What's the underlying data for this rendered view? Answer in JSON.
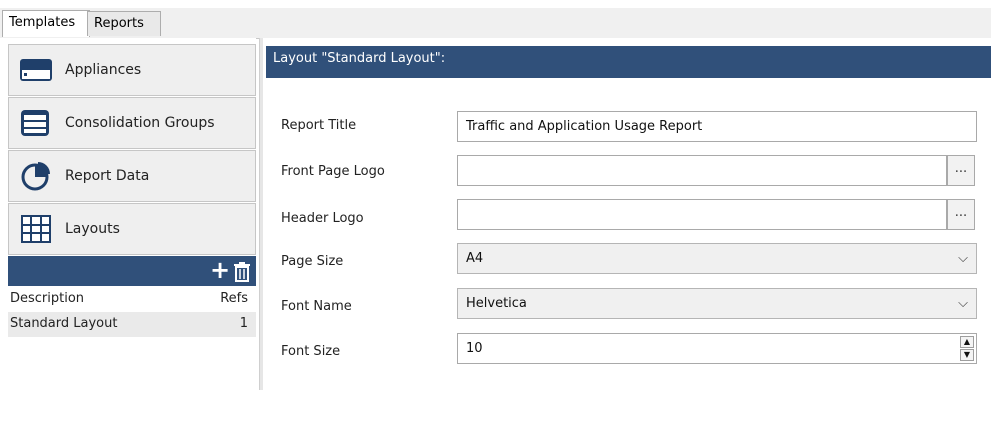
{
  "tabs": [
    {
      "label": "Templates"
    },
    {
      "label": "Reports"
    }
  ],
  "sidebar": {
    "items": [
      {
        "label": "Appliances",
        "icon": "appliance-icon"
      },
      {
        "label": "Consolidation Groups",
        "icon": "consolidation-groups-icon"
      },
      {
        "label": "Report Data",
        "icon": "pie-chart-icon"
      },
      {
        "label": "Layouts",
        "icon": "grid-icon"
      }
    ],
    "toolbar": {
      "add": "+",
      "delete_icon": "trash-icon"
    },
    "grid": {
      "columns": [
        "Description",
        "Refs"
      ],
      "rows": [
        {
          "description": "Standard Layout",
          "refs": "1"
        }
      ]
    }
  },
  "panel": {
    "header": "Layout \"Standard Layout\":",
    "fields": {
      "report_title": {
        "label": "Report Title",
        "value": "Traffic and Application Usage Report"
      },
      "front_logo": {
        "label": "Front Page Logo",
        "value": "",
        "browse": "..."
      },
      "header_logo": {
        "label": "Header Logo",
        "value": "",
        "browse": "..."
      },
      "page_size": {
        "label": "Page Size",
        "value": "A4"
      },
      "font_name": {
        "label": "Font Name",
        "value": "Helvetica"
      },
      "font_size": {
        "label": "Font Size",
        "value": "10"
      }
    }
  },
  "colors": {
    "accent": "#30507a",
    "nav_bg": "#efefef"
  }
}
